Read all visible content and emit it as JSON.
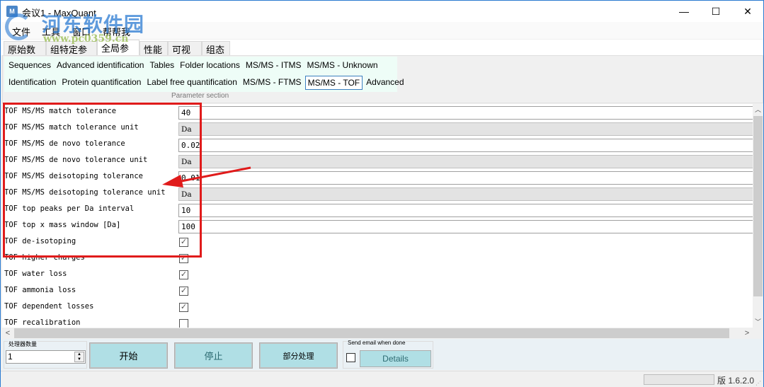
{
  "window": {
    "title": "会议1 - MaxQuant",
    "app_icon": "M",
    "controls": {
      "minimize": "—",
      "maximize": "☐",
      "close": "✕"
    }
  },
  "watermark": {
    "text": "河东软件园",
    "url_text": "www.pc0359.cn"
  },
  "menu": [
    {
      "label": "文件"
    },
    {
      "label": "工具"
    },
    {
      "label": "窗口"
    },
    {
      "label": "帮帮我"
    }
  ],
  "main_tabs": [
    {
      "label": "原始数据",
      "active": false
    },
    {
      "label": "组特定参数",
      "active": false
    },
    {
      "label": "全局参数",
      "active": true
    },
    {
      "label": "性能",
      "active": false
    },
    {
      "label": "可视化",
      "active": false
    },
    {
      "label": "组态",
      "active": false
    }
  ],
  "sub_tabs_row1": [
    {
      "label": "Sequences"
    },
    {
      "label": "Advanced identification"
    },
    {
      "label": "Tables"
    },
    {
      "label": "Folder locations"
    },
    {
      "label": "MS/MS - ITMS"
    },
    {
      "label": "MS/MS - Unknown"
    }
  ],
  "sub_tabs_row2": [
    {
      "label": "Identification",
      "active": false
    },
    {
      "label": "Protein quantification",
      "active": false
    },
    {
      "label": "Label free quantification",
      "active": false
    },
    {
      "label": "MS/MS - FTMS",
      "active": false
    },
    {
      "label": "MS/MS - TOF",
      "active": true
    },
    {
      "label": "Advanced",
      "active": false
    }
  ],
  "parameter_section_label": "Parameter section",
  "parameters": [
    {
      "label": "TOF MS/MS match tolerance",
      "type": "input",
      "value": "40"
    },
    {
      "label": "TOF MS/MS match tolerance unit",
      "type": "select",
      "value": "Da"
    },
    {
      "label": "TOF MS/MS de novo tolerance",
      "type": "input",
      "value": "0.02"
    },
    {
      "label": "TOF MS/MS de novo tolerance unit",
      "type": "select",
      "value": "Da"
    },
    {
      "label": "TOF MS/MS deisotoping tolerance",
      "type": "input",
      "value": "0.01"
    },
    {
      "label": "TOF MS/MS deisotoping tolerance unit",
      "type": "select",
      "value": "Da"
    },
    {
      "label": "TOF top peaks per Da interval",
      "type": "input",
      "value": "10"
    },
    {
      "label": "TOF top x mass window [Da]",
      "type": "input",
      "value": "100"
    },
    {
      "label": "TOF de-isotoping",
      "type": "checkbox",
      "checked": true
    },
    {
      "label": "TOF higher charges",
      "type": "checkbox",
      "checked": true
    },
    {
      "label": "TOF water loss",
      "type": "checkbox",
      "checked": true
    },
    {
      "label": "TOF ammonia loss",
      "type": "checkbox",
      "checked": true
    },
    {
      "label": "TOF dependent losses",
      "type": "checkbox",
      "checked": true
    },
    {
      "label": "TOF recalibration",
      "type": "checkbox",
      "checked": false
    }
  ],
  "bottom": {
    "threads_label": "处理器数量",
    "threads_value": "1",
    "start_label": "开始",
    "stop_label": "停止",
    "partial_label": "部分处理",
    "email_group_label": "Send email when done",
    "email_checked": false,
    "details_label": "Details"
  },
  "status": {
    "version": "版 1.6.2.0"
  },
  "colors": {
    "annotation_red": "#e01b1b",
    "button_bg": "#b0dfe5",
    "active_tab_border": "#3b7fbf"
  }
}
